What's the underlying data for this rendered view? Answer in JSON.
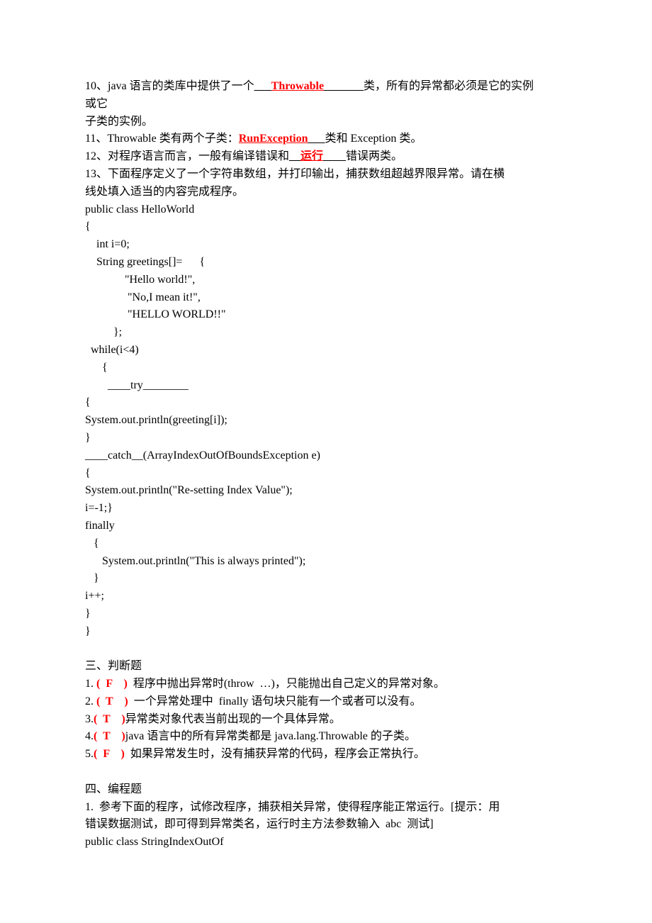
{
  "lines": [
    {
      "segments": [
        {
          "t": "10、java 语言的类库中提供了一个"
        },
        {
          "t": "___",
          "cls": "u"
        },
        {
          "t": "Throwable",
          "cls": "red u"
        },
        {
          "t": "_______",
          "cls": "u"
        },
        {
          "t": "类，所有的异常都必须是它的实例"
        }
      ]
    },
    {
      "segments": [
        {
          "t": "或它"
        }
      ]
    },
    {
      "segments": [
        {
          "t": "子类的实例。"
        }
      ]
    },
    {
      "segments": [
        {
          "t": "11、Throwable 类有两个子类："
        },
        {
          "t": "RunException",
          "cls": "red u"
        },
        {
          "t": "___",
          "cls": "u"
        },
        {
          "t": "类和 Exception 类。"
        }
      ]
    },
    {
      "segments": [
        {
          "t": "12、对程序语言而言，一般有编译错误和"
        },
        {
          "t": "__",
          "cls": "u"
        },
        {
          "t": "运行",
          "cls": "red u"
        },
        {
          "t": "____",
          "cls": "u"
        },
        {
          "t": "错误两类。"
        }
      ]
    },
    {
      "segments": [
        {
          "t": "13、下面程序定义了一个字符串数组，并打印输出，捕获数组超越界限异常。请在横"
        }
      ]
    },
    {
      "segments": [
        {
          "t": "线处填入适当的内容完成程序。"
        }
      ]
    },
    {
      "segments": [
        {
          "t": "public class HelloWorld"
        }
      ]
    },
    {
      "segments": [
        {
          "t": "{"
        }
      ]
    },
    {
      "segments": [
        {
          "t": "    int i=0;"
        }
      ]
    },
    {
      "segments": [
        {
          "t": "    String greetings[]=      {"
        }
      ]
    },
    {
      "segments": [
        {
          "t": "              \"Hello world!\","
        }
      ]
    },
    {
      "segments": [
        {
          "t": "               \"No,I mean it!\","
        }
      ]
    },
    {
      "segments": [
        {
          "t": "               \"HELLO WORLD!!\""
        }
      ]
    },
    {
      "segments": [
        {
          "t": "          };"
        }
      ]
    },
    {
      "segments": [
        {
          "t": "  while(i<4)"
        }
      ]
    },
    {
      "segments": [
        {
          "t": "      {"
        }
      ]
    },
    {
      "segments": [
        {
          "t": "        ____try________"
        }
      ]
    },
    {
      "segments": [
        {
          "t": "{"
        }
      ]
    },
    {
      "segments": [
        {
          "t": "System.out.println(greeting[i]);"
        }
      ]
    },
    {
      "segments": [
        {
          "t": "}"
        }
      ]
    },
    {
      "segments": [
        {
          "t": "____catch__(ArrayIndexOutOfBoundsException e)"
        }
      ]
    },
    {
      "segments": [
        {
          "t": "{"
        }
      ]
    },
    {
      "segments": [
        {
          "t": "System.out.println(\"Re-setting Index Value\");"
        }
      ]
    },
    {
      "segments": [
        {
          "t": "i=-1;}"
        }
      ]
    },
    {
      "segments": [
        {
          "t": "finally"
        }
      ]
    },
    {
      "segments": [
        {
          "t": "   {"
        }
      ]
    },
    {
      "segments": [
        {
          "t": "      System.out.println(\"This is always printed\");"
        }
      ]
    },
    {
      "segments": [
        {
          "t": "   }"
        }
      ]
    },
    {
      "segments": [
        {
          "t": "i++;"
        }
      ]
    },
    {
      "segments": [
        {
          "t": "}"
        }
      ]
    },
    {
      "segments": [
        {
          "t": "}"
        }
      ]
    },
    {
      "segments": [
        {
          "t": ""
        }
      ]
    },
    {
      "segments": [
        {
          "t": "三、判断题"
        }
      ]
    },
    {
      "segments": [
        {
          "t": "1. "
        },
        {
          "t": "(  F    )",
          "cls": "red"
        },
        {
          "t": "  程序中抛出异常时(throw  …)，只能抛出自己定义的异常对象。"
        }
      ]
    },
    {
      "segments": [
        {
          "t": "2. "
        },
        {
          "t": "(  T    )",
          "cls": "red"
        },
        {
          "t": "  一个异常处理中  finally 语句块只能有一个或者可以没有。"
        }
      ]
    },
    {
      "segments": [
        {
          "t": "3."
        },
        {
          "t": "(  T    )",
          "cls": "red"
        },
        {
          "t": "异常类对象代表当前出现的一个具体异常。"
        }
      ]
    },
    {
      "segments": [
        {
          "t": "4."
        },
        {
          "t": "(  T    )",
          "cls": "red"
        },
        {
          "t": "java 语言中的所有异常类都是 java.lang.Throwable 的子类。"
        }
      ]
    },
    {
      "segments": [
        {
          "t": "5."
        },
        {
          "t": "(  F    )",
          "cls": "red"
        },
        {
          "t": "  如果异常发生时，没有捕获异常的代码，程序会正常执行。"
        }
      ]
    },
    {
      "segments": [
        {
          "t": ""
        }
      ]
    },
    {
      "segments": [
        {
          "t": "四、编程题"
        }
      ]
    },
    {
      "segments": [
        {
          "t": "1.  参考下面的程序，试修改程序，捕获相关异常，使得程序能正常运行。[提示：用"
        }
      ]
    },
    {
      "segments": [
        {
          "t": "错误数据测试，即可得到异常类名，运行时主方法参数输入  abc  测试]"
        }
      ]
    },
    {
      "segments": [
        {
          "t": "public class StringIndexOutOf"
        }
      ]
    }
  ]
}
